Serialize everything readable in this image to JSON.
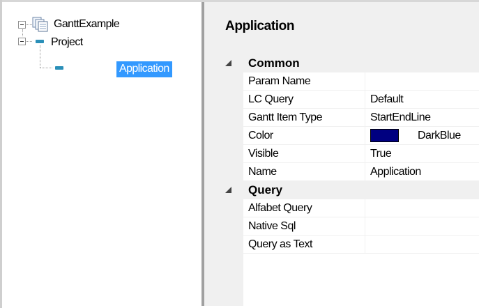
{
  "tree": {
    "root": {
      "label": "GanttExample",
      "icon": "documents-icon",
      "expanded": true
    },
    "project": {
      "label": "Project",
      "icon": "node-dash-icon",
      "expanded": true
    },
    "application": {
      "label": "Application",
      "icon": "node-dash-icon",
      "selected": true
    }
  },
  "properties": {
    "title": "Application",
    "categories": [
      {
        "name": "Common",
        "expanded": true,
        "rows": [
          {
            "name": "Param Name",
            "value": ""
          },
          {
            "name": "LC Query",
            "value": "Default"
          },
          {
            "name": "Gantt Item Type",
            "value": "StartEndLine"
          },
          {
            "name": "Color",
            "value": "DarkBlue",
            "swatch": "#000080"
          },
          {
            "name": "Visible",
            "value": "True"
          },
          {
            "name": "Name",
            "value": "Application"
          }
        ]
      },
      {
        "name": "Query",
        "expanded": true,
        "rows": [
          {
            "name": "Alfabet Query",
            "value": ""
          },
          {
            "name": "Native Sql",
            "value": ""
          },
          {
            "name": "Query as Text",
            "value": ""
          }
        ]
      }
    ]
  },
  "colors": {
    "selection": "#3399ff",
    "panel_bg": "#f0f0f0",
    "splitter": "#a0a0a0",
    "tree_node": "#2a8fb8"
  }
}
